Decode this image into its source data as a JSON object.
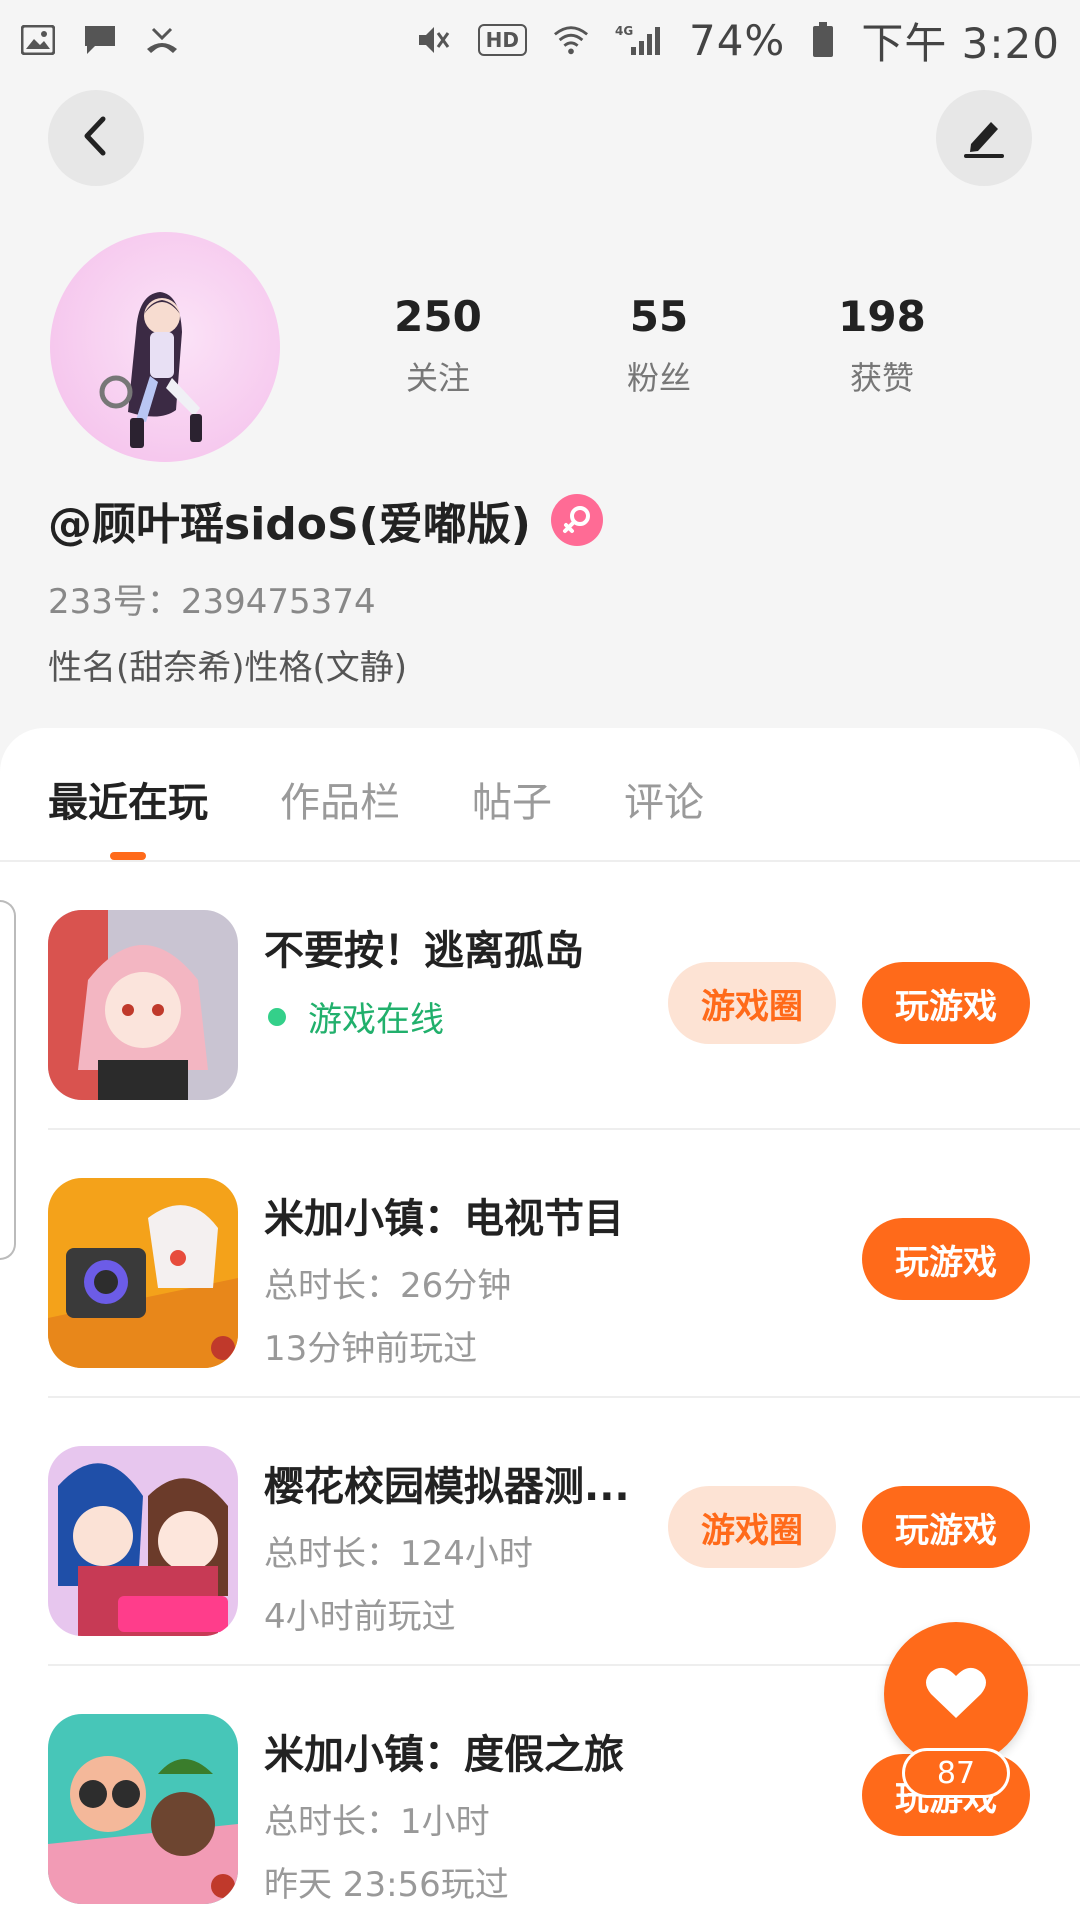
{
  "status_bar": {
    "battery": "74%",
    "time": "下午 3:20",
    "hd_label": "HD",
    "network_label": "4G"
  },
  "profile": {
    "stats": [
      {
        "value": "250",
        "label": "关注"
      },
      {
        "value": "55",
        "label": "粉丝"
      },
      {
        "value": "198",
        "label": "获赞"
      }
    ],
    "nickname": "@顾叶瑶sidoS(爱嘟版)",
    "uid": "233号：239475374",
    "bio": "性名(甜奈希)性格(文静)"
  },
  "tabs": [
    "最近在玩",
    "作品栏",
    "帖子",
    "评论"
  ],
  "games": [
    {
      "title": "不要按！逃离孤岛",
      "online": "游戏在线",
      "circle_label": "游戏圈",
      "play_label": "玩游戏"
    },
    {
      "title": "米加小镇：电视节目",
      "duration": "总时长：26分钟",
      "last_played": "13分钟前玩过",
      "play_label": "玩游戏"
    },
    {
      "title": "樱花校园模拟器测...",
      "duration": "总时长：124小时",
      "last_played": "4小时前玩过",
      "circle_label": "游戏圈",
      "play_label": "玩游戏"
    },
    {
      "title": "米加小镇：度假之旅",
      "duration": "总时长：1小时",
      "last_played": "昨天 23:56玩过",
      "play_label": "玩游戏"
    }
  ],
  "fab": {
    "count": "87"
  },
  "colors": {
    "accent": "#ff6a1a",
    "accent_light": "#fde3d4",
    "online": "#21b06c",
    "gender": "#ff6b95"
  }
}
